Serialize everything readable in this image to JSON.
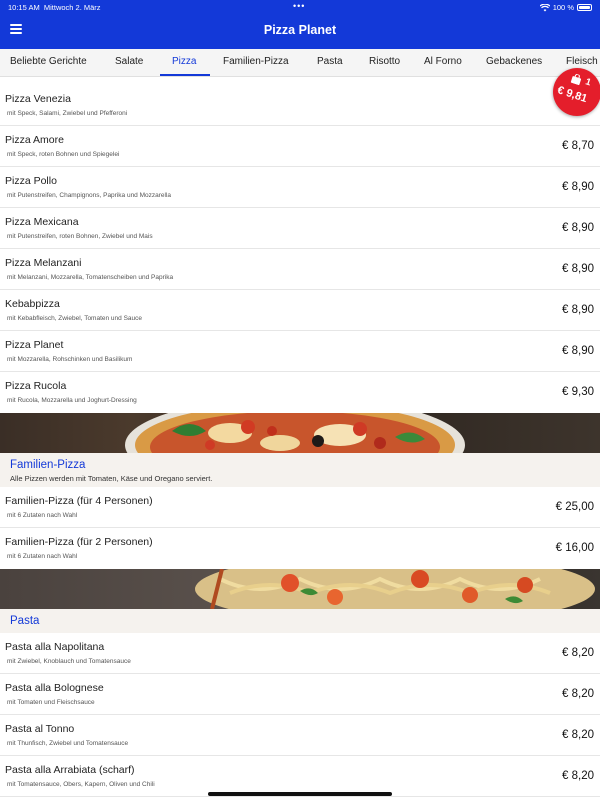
{
  "status_bar": {
    "time": "10:15 AM",
    "date": "Mittwoch 2. März",
    "battery": "100 %"
  },
  "header": {
    "title": "Pizza Planet"
  },
  "tabs": [
    {
      "label": "Beliebte Gerichte",
      "active": false
    },
    {
      "label": "Salate",
      "active": false
    },
    {
      "label": "Pizza",
      "active": true
    },
    {
      "label": "Familien-Pizza",
      "active": false
    },
    {
      "label": "Pasta",
      "active": false
    },
    {
      "label": "Risotto",
      "active": false
    },
    {
      "label": "Al Forno",
      "active": false
    },
    {
      "label": "Gebackenes",
      "active": false
    },
    {
      "label": "Fleisch",
      "active": false
    }
  ],
  "cart": {
    "count": "1",
    "total": "€ 9,81",
    "color": "#e41e2b"
  },
  "pizza_items": [
    {
      "name": "Pizza Venezia",
      "desc": "mit Speck, Salami, Zwiebel und Pfefferoni",
      "price": ""
    },
    {
      "name": "Pizza Amore",
      "desc": "mit Speck, roten Bohnen und Spiegelei",
      "price": "€ 8,70"
    },
    {
      "name": "Pizza Pollo",
      "desc": "mit Putenstreifen, Champignons, Paprika und Mozzarella",
      "price": "€ 8,90"
    },
    {
      "name": "Pizza Mexicana",
      "desc": "mit Putenstreifen, roten Bohnen, Zwiebel und Mais",
      "price": "€ 8,90"
    },
    {
      "name": "Pizza Melanzani",
      "desc": "mit Melanzani, Mozzarella, Tomatenscheiben und Paprika",
      "price": "€ 8,90"
    },
    {
      "name": "Kebabpizza",
      "desc": "mit Kebabfleisch, Zwiebel, Tomaten und Sauce",
      "price": "€ 8,90"
    },
    {
      "name": "Pizza Planet",
      "desc": "mit Mozzarella, Rohschinken und Basilikum",
      "price": "€ 8,90"
    },
    {
      "name": "Pizza Rucola",
      "desc": "mit Rucola, Mozzarella und Joghurt-Dressing",
      "price": "€ 9,30"
    }
  ],
  "familien_section": {
    "title": "Familien-Pizza",
    "subtitle": "Alle Pizzen werden mit Tomaten, Käse und Oregano serviert.",
    "items": [
      {
        "name": "Familien-Pizza (für 4 Personen)",
        "desc": "mit 6 Zutaten nach Wahl",
        "price": "€ 25,00"
      },
      {
        "name": "Familien-Pizza (für 2 Personen)",
        "desc": "mit 6 Zutaten nach Wahl",
        "price": "€ 16,00"
      }
    ]
  },
  "pasta_section": {
    "title": "Pasta",
    "items": [
      {
        "name": "Pasta alla Napolitana",
        "desc": "mit Zwiebel, Knoblauch und Tomatensauce",
        "price": "€ 8,20"
      },
      {
        "name": "Pasta alla Bolognese",
        "desc": "mit Tomaten und Fleischsauce",
        "price": "€ 8,20"
      },
      {
        "name": "Pasta al Tonno",
        "desc": "mit Thunfisch, Zwiebel und Tomatensauce",
        "price": "€ 8,20"
      },
      {
        "name": "Pasta alla Arrabiata (scharf)",
        "desc": "mit Tomatensauce, Obers, Kapern, Oliven und Chili",
        "price": "€ 8,20"
      }
    ]
  },
  "colors": {
    "brand": "#1339d8",
    "cart": "#e41e2b"
  }
}
